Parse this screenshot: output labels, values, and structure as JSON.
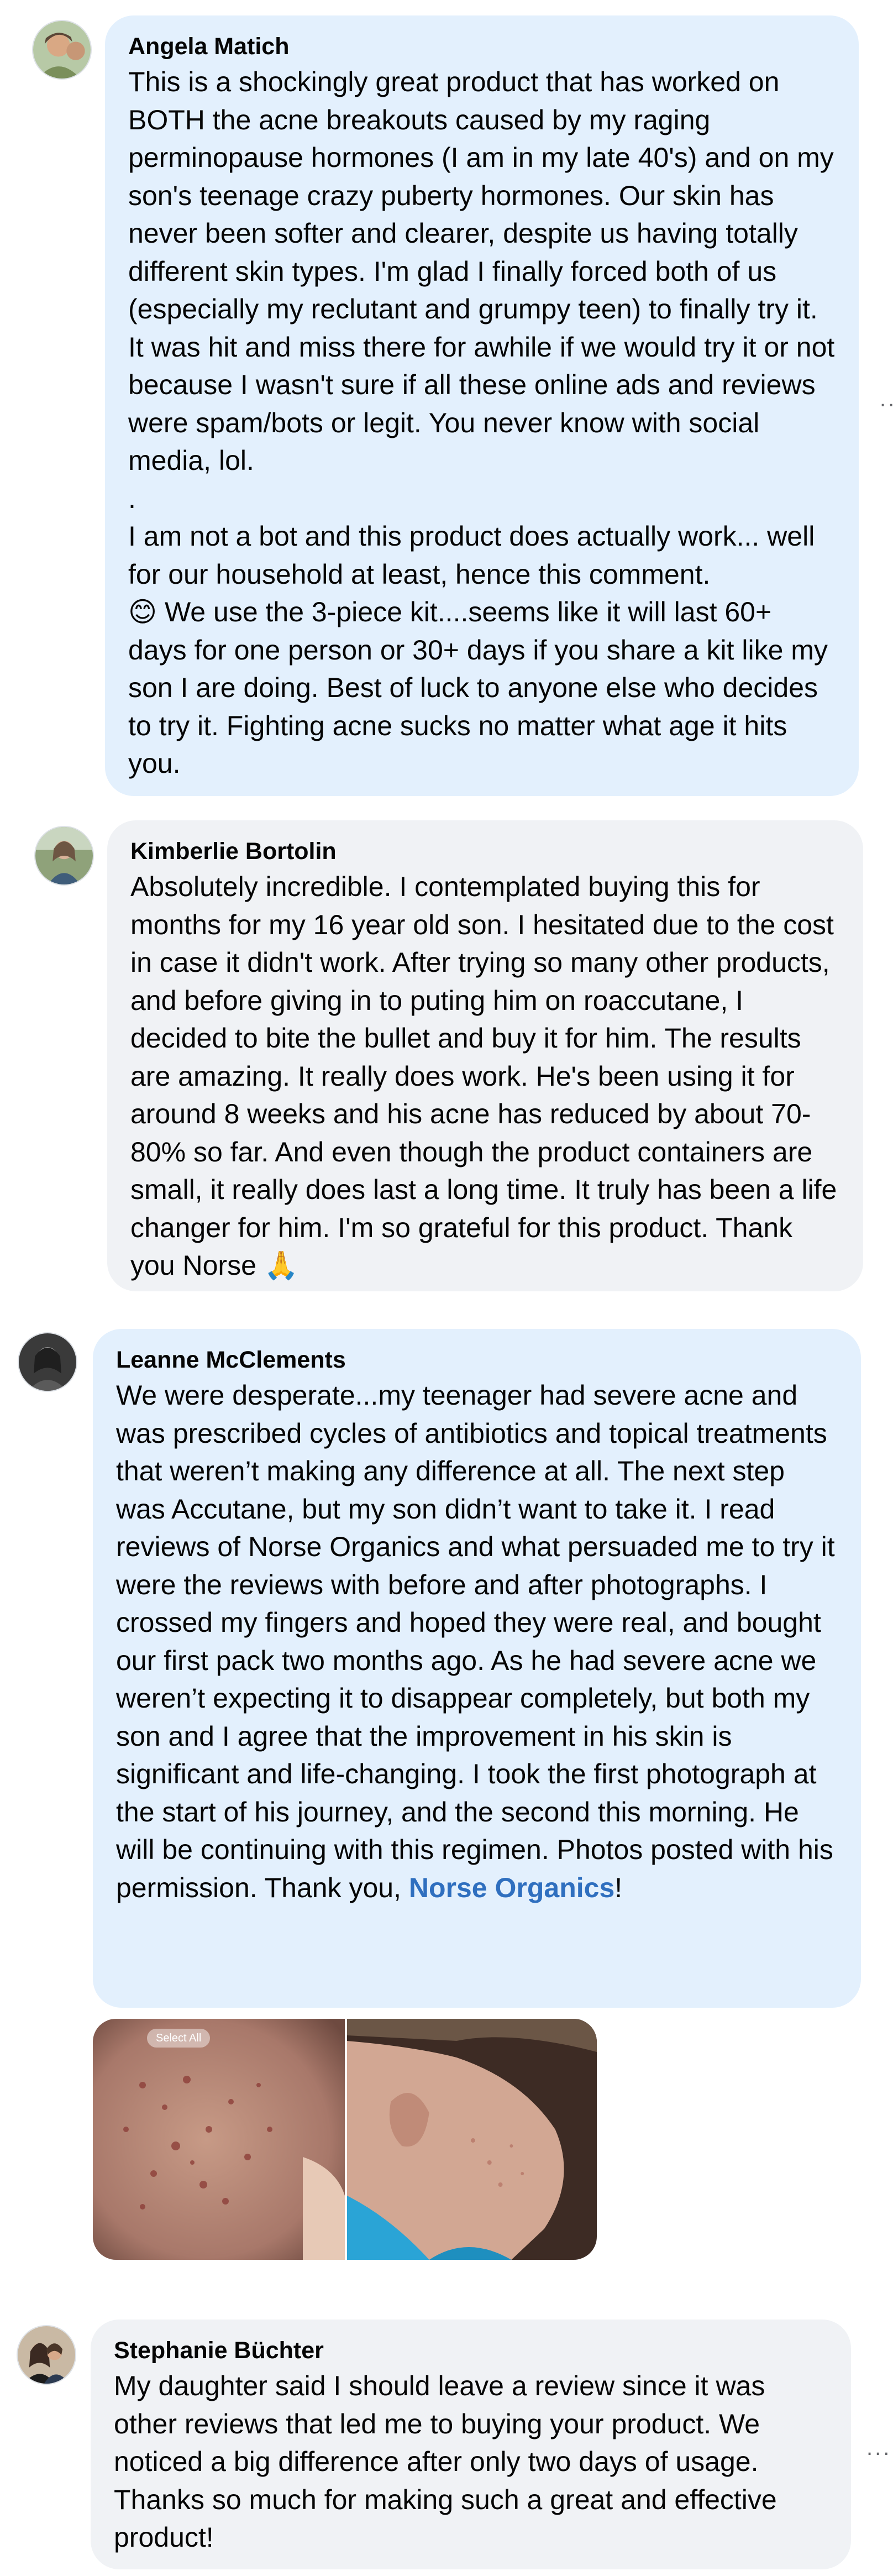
{
  "comments": [
    {
      "author": "Angela Matich",
      "text_before_emoji": "This is a shockingly great product that has worked on BOTH the acne breakouts caused by my raging perminopause hormones (I am in my late 40's) and on my son's teenage crazy puberty hormones. Our skin has never been softer and clearer, despite us having totally different skin types. I'm glad I finally forced both of us (especially my reclutant and grumpy teen) to finally try it. It was hit and miss there for awhile if we would try it or not because I wasn't sure if all these online ads and reviews were spam/bots or legit. You never know with social media, lol.\n.\nI am not a bot and this product does actually work... well for our household at least, hence this comment.",
      "emoji": "😊",
      "text_after_emoji": " We use the 3-piece kit....seems like it will last 60+ days for one person or 30+ days if you share a kit like my son I are doing. Best of luck to anyone else who decides to try it. Fighting acne sucks no matter what age it hits you.",
      "more_label": "..."
    },
    {
      "author": "Kimberlie Bortolin",
      "text": "Absolutely incredible. I contemplated buying this for months for my 16 year old son. I hesitated due to the cost in case it didn't work. After trying so many other products, and before giving in to puting him on roaccutane, I decided to bite the bullet and buy it for him. The results are amazing. It really does work. He's been using it for around 8 weeks and his acne has reduced by about 70-80% so far. And even though the product containers are small, it really does last a long time. It truly has been a life changer for him. I'm so grateful for this product. Thank you Norse ",
      "emoji": "🙏"
    },
    {
      "author": "Leanne McClements",
      "text": "We were desperate...my teenager had severe acne and was prescribed cycles of antibiotics and topical treatments that weren’t making any difference at all. The next step was Accutane, but my son didn’t want to take it. I read reviews of Norse Organics and what persuaded me to try it were the reviews with before and after photographs. I crossed my fingers and hoped they were real, and bought our first pack two months ago. As he had severe acne we weren’t expecting it to disappear completely, but both my son and I agree that the improvement in his skin is significant and life-changing. I took the first photograph at the start of his journey, and the second this morning. He will be continuing with this regimen. Photos posted with his permission. Thank you, ",
      "link": "Norse Organics",
      "text_end": "!",
      "photo_chip": "Select All"
    },
    {
      "author": "Stephanie Büchter",
      "text": "My daughter said I should leave a review since it was other reviews that led me to buying your product. We noticed a big difference after only two days of usage. Thanks so much for making such a great and effective product!",
      "more_label": "..."
    }
  ],
  "colors": {
    "bubble_blue": "#e3f0fd",
    "bubble_grey": "#f0f2f5",
    "link": "#2f6fbf"
  }
}
